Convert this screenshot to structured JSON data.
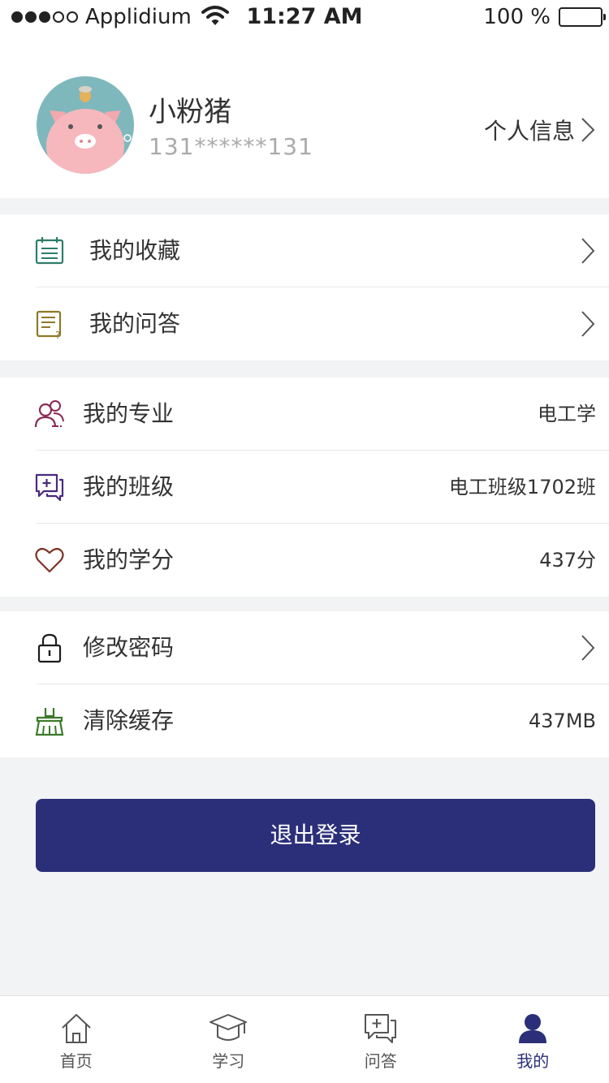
{
  "status_bar": {
    "carrier": "Applidium",
    "time": "11:27 AM",
    "battery": "100 %"
  },
  "profile": {
    "name": "小粉猪",
    "phone": "131******131",
    "info_link": "个人信息"
  },
  "menu": {
    "favorites": "我的收藏",
    "qa": "我的问答",
    "major": {
      "label": "我的专业",
      "value": "电工学"
    },
    "class": {
      "label": "我的班级",
      "value": "电工班级1702班"
    },
    "credits": {
      "label": "我的学分",
      "value": "437分"
    },
    "password": "修改密码",
    "cache": {
      "label": "清除缓存",
      "value": "437MB"
    }
  },
  "logout_label": "退出登录",
  "tabs": [
    {
      "label": "首页",
      "icon": "home-icon"
    },
    {
      "label": "学习",
      "icon": "graduation-cap-icon"
    },
    {
      "label": "问答",
      "icon": "chat-plus-icon"
    },
    {
      "label": "我的",
      "icon": "user-icon",
      "active": true
    }
  ],
  "colors": {
    "primary": "#2b2f79",
    "background": "#f2f3f5"
  }
}
